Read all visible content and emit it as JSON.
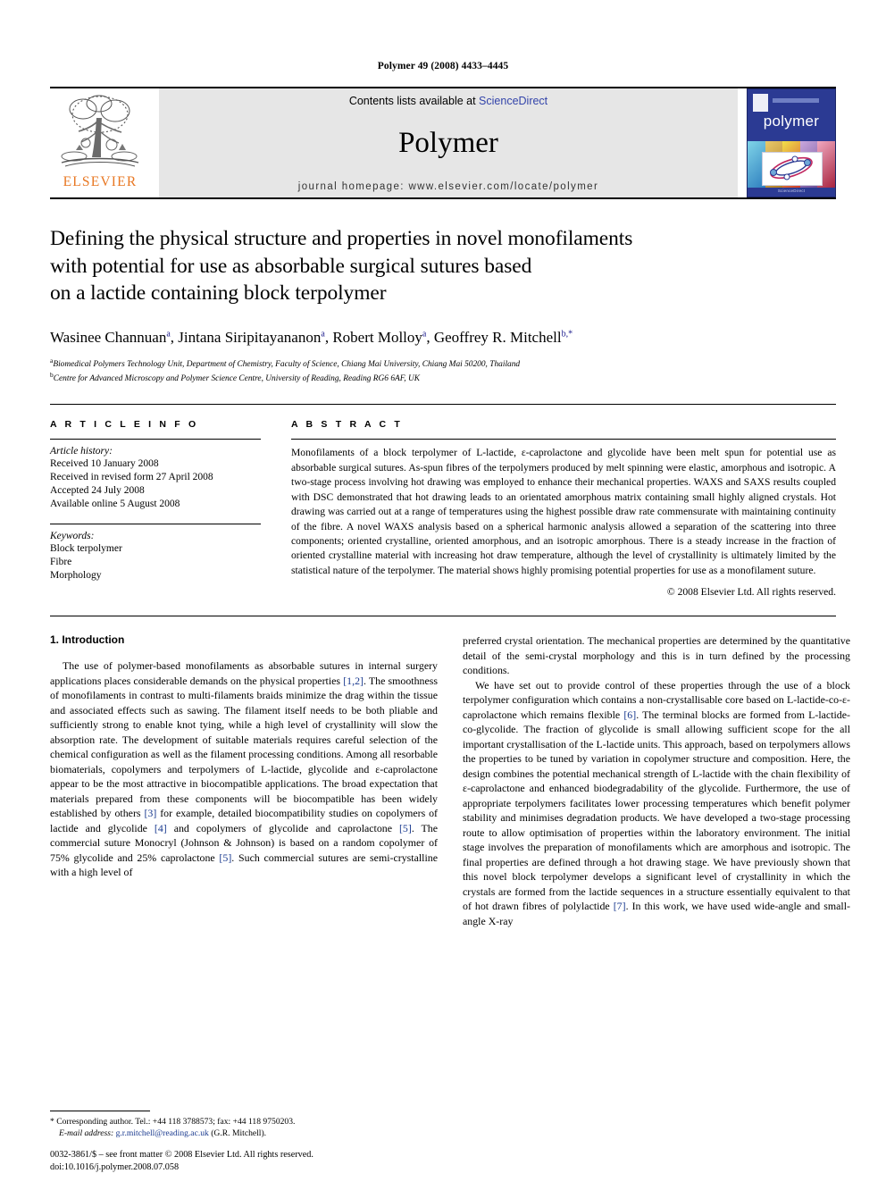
{
  "running_head": "Polymer 49 (2008) 4433–4445",
  "masthead": {
    "publisher_name": "ELSEVIER",
    "contents_prefix": "Contents lists available at ",
    "contents_link": "ScienceDirect",
    "journal_name": "Polymer",
    "homepage": "journal homepage: www.elsevier.com/locate/polymer",
    "cover_brand": "polymer",
    "cover_footer": "ScienceDirect",
    "cover_bg": "#2b3a93",
    "link_color": "#3344aa",
    "elsevier_orange": "#E87722"
  },
  "article": {
    "title_line1": "Defining the physical structure and properties in novel monofilaments",
    "title_line2": "with potential for use as absorbable surgical sutures based",
    "title_line3": "on a lactide containing block terpolymer",
    "authors": "Wasinee Channuan , Jintana Siripitayananon , Robert Molloy , Geoffrey R. Mitchell",
    "author_list": [
      {
        "name": "Wasinee Channuan",
        "marks": "a"
      },
      {
        "name": "Jintana Siripitayananon",
        "marks": "a"
      },
      {
        "name": "Robert Molloy",
        "marks": "a"
      },
      {
        "name": "Geoffrey R. Mitchell",
        "marks": "b,*"
      }
    ],
    "affiliation_a_mark": "a",
    "affiliation_a": "Biomedical Polymers Technology Unit, Department of Chemistry, Faculty of Science, Chiang Mai University, Chiang Mai 50200, Thailand",
    "affiliation_b_mark": "b",
    "affiliation_b": "Centre for Advanced Microscopy and Polymer Science Centre, University of Reading, Reading RG6 6AF, UK"
  },
  "article_info": {
    "heading": "A R T I C L E  I N F O",
    "history_label": "Article history:",
    "history": [
      "Received 10 January 2008",
      "Received in revised form 27 April 2008",
      "Accepted 24 July 2008",
      "Available online 5 August 2008"
    ],
    "keywords_label": "Keywords:",
    "keywords": [
      "Block terpolymer",
      "Fibre",
      "Morphology"
    ]
  },
  "abstract": {
    "heading": "A B S T R A C T",
    "text": "Monofilaments of a block terpolymer of L-lactide, ε-caprolactone and glycolide have been melt spun for potential use as absorbable surgical sutures. As-spun fibres of the terpolymers produced by melt spinning were elastic, amorphous and isotropic. A two-stage process involving hot drawing was employed to enhance their mechanical properties. WAXS and SAXS results coupled with DSC demonstrated that hot drawing leads to an orientated amorphous matrix containing small highly aligned crystals. Hot drawing was carried out at a range of temperatures using the highest possible draw rate commensurate with maintaining continuity of the fibre. A novel WAXS analysis based on a spherical harmonic analysis allowed a separation of the scattering into three components; oriented crystalline, oriented amorphous, and an isotropic amorphous. There is a steady increase in the fraction of oriented crystalline material with increasing hot draw temperature, although the level of crystallinity is ultimately limited by the statistical nature of the terpolymer. The material shows highly promising potential properties for use as a monofilament suture.",
    "copyright": "© 2008 Elsevier Ltd. All rights reserved."
  },
  "introduction": {
    "section_number_title": "1.  Introduction",
    "left_para1_part1": "The use of polymer-based monofilaments as absorbable sutures in internal surgery applications places considerable demands on the physical properties ",
    "left_ref_12": "[1,2]",
    "left_para1_part2": ". The smoothness of monofilaments in contrast to multi-filaments braids minimize the drag within the tissue and associated effects such as sawing. The filament itself needs to be both pliable and sufficiently strong to enable knot tying, while a high level of crystallinity will slow the absorption rate. The development of suitable materials requires careful selection of the chemical configuration as well as the filament processing conditions. Among all resorbable biomaterials, copolymers and terpolymers of L-lactide, glycolide and ε-caprolactone appear to be the most attractive in biocompatible applications. The broad expectation that materials prepared from these components will be biocompatible has been widely established by others ",
    "left_ref_3": "[3]",
    "left_para1_part3": " for example, detailed biocompatibility studies on copolymers of lactide and glycolide ",
    "left_ref_4": "[4]",
    "left_para1_part4": " and copolymers of glycolide and caprolactone ",
    "left_ref_5": "[5]",
    "left_para1_part5": ". The commercial suture Monocryl (Johnson & Johnson) is based on a random copolymer of 75% glycolide and 25% caprolactone ",
    "left_ref_5b": "[5]",
    "left_para1_part6": ". Such commercial sutures are semi-crystalline with a high level of",
    "right_para_cont": "preferred crystal orientation. The mechanical properties are determined by the quantitative detail of the semi-crystal morphology and this is in turn defined by the processing conditions.",
    "right_para2_part1": "We have set out to provide control of these properties through the use of a block terpolymer configuration which contains a non-crystallisable core based on L-lactide-co-ε-caprolactone which remains flexible ",
    "right_ref_6": "[6]",
    "right_para2_part2": ". The terminal blocks are formed from L-lactide-co-glycolide. The fraction of glycolide is small allowing sufficient scope for the all important crystallisation of the L-lactide units. This approach, based on terpolymers allows the properties to be tuned by variation in copolymer structure and composition. Here, the design combines the potential mechanical strength of L-lactide with the chain flexibility of ε-caprolactone and enhanced biodegradability of the glycolide. Furthermore, the use of appropriate terpolymers facilitates lower processing temperatures which benefit polymer stability and minimises degradation products. We have developed a two-stage processing route to allow optimisation of properties within the laboratory environment. The initial stage involves the preparation of monofilaments which are amorphous and isotropic. The final properties are defined through a hot drawing stage. We have previously shown that this novel block terpolymer develops a significant level of crystallinity in which the crystals are formed from the lactide sequences in a structure essentially equivalent to that of hot drawn fibres of polylactide ",
    "right_ref_7": "[7]",
    "right_para2_part3": ". In this work, we have used wide-angle and small-angle X-ray"
  },
  "footnotes": {
    "corresponding_mark": "*",
    "corresponding_text": " Corresponding author. Tel.: +44 118 3788573; fax: +44 118 9750203.",
    "email_label": "E-mail address:",
    "email": "g.r.mitchell@reading.ac.uk",
    "email_owner": "(G.R. Mitchell).",
    "issn_line": "0032-3861/$ – see front matter © 2008 Elsevier Ltd. All rights reserved.",
    "doi_line": "doi:10.1016/j.polymer.2008.07.058"
  }
}
